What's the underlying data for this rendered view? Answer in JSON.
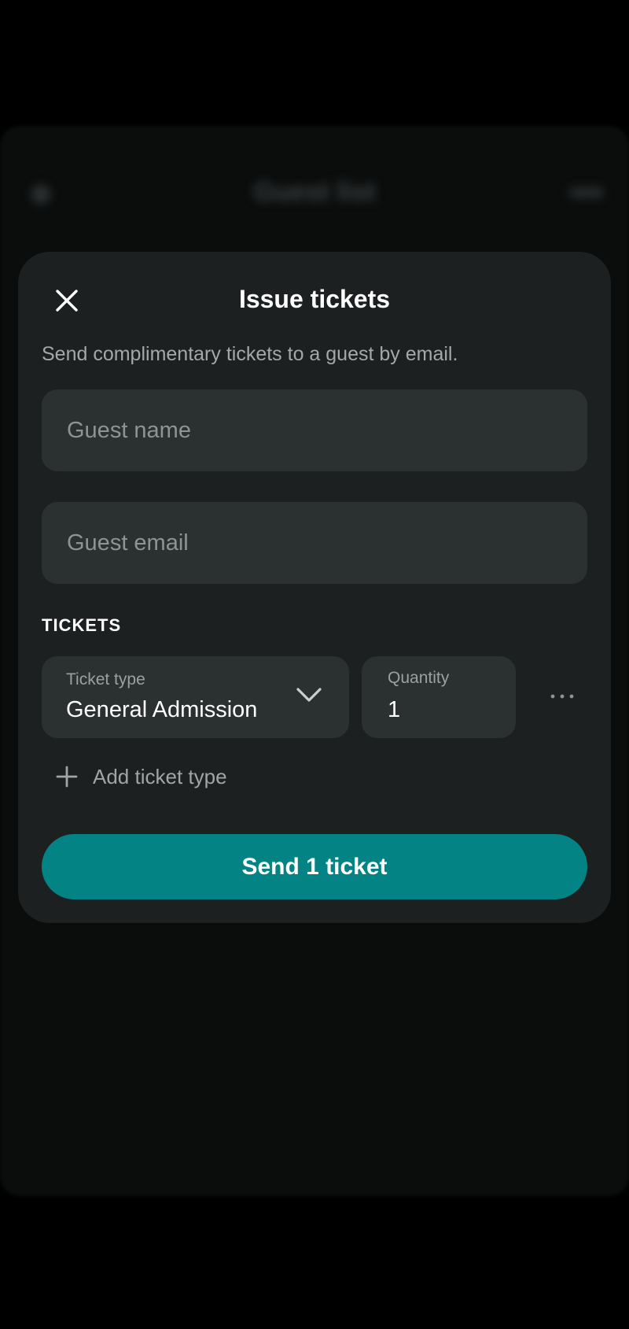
{
  "background": {
    "title": "Guest list"
  },
  "modal": {
    "title": "Issue tickets",
    "subtitle": "Send complimentary tickets to a guest by email.",
    "guest_name": {
      "placeholder": "Guest name",
      "value": ""
    },
    "guest_email": {
      "placeholder": "Guest email",
      "value": ""
    },
    "tickets_section_label": "TICKETS",
    "ticket_type": {
      "caption": "Ticket type",
      "value": "General Admission"
    },
    "quantity": {
      "caption": "Quantity",
      "value": "1"
    },
    "add_ticket_type_label": "Add ticket type",
    "send_button_label": "Send 1 ticket"
  },
  "icons": {
    "close": "close-icon",
    "chevron": "chevron-down-icon",
    "more": "more-horizontal-icon",
    "plus": "plus-icon"
  },
  "colors": {
    "accent": "#038383",
    "sheet_bg": "#1c2020",
    "field_bg": "#2b3131"
  }
}
